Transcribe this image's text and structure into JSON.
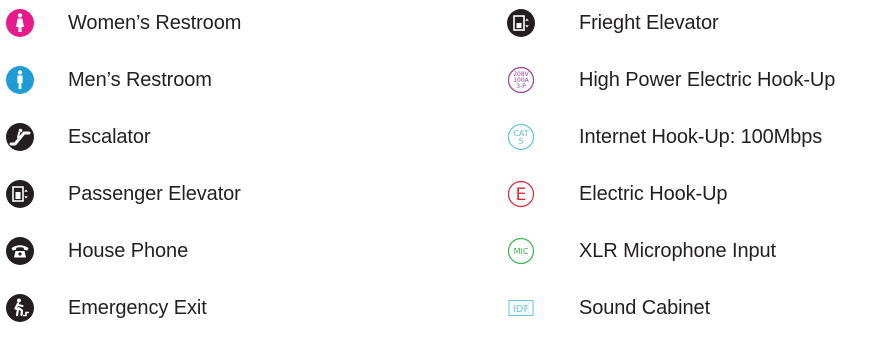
{
  "colors": {
    "women": "#e8198a",
    "men": "#1d9cd8",
    "dark": "#231f20",
    "high_power": "#9b3f98",
    "internet": "#5fc4e8",
    "electric": "#e8262e",
    "microphone": "#3bb54a",
    "sound_cabinet": "#5fc4e8"
  },
  "legend": {
    "left": [
      {
        "icon": "women-restroom-icon",
        "label": "Women’s Restroom"
      },
      {
        "icon": "men-restroom-icon",
        "label": "Men’s Restroom"
      },
      {
        "icon": "escalator-icon",
        "label": "Escalator"
      },
      {
        "icon": "passenger-elevator-icon",
        "label": "Passenger Elevator"
      },
      {
        "icon": "house-phone-icon",
        "label": "House Phone"
      },
      {
        "icon": "emergency-exit-icon",
        "label": "Emergency Exit"
      }
    ],
    "right": [
      {
        "icon": "freight-elevator-icon",
        "label": "Frieght Elevator"
      },
      {
        "icon": "high-power-electric-icon",
        "label": "High Power Electric Hook-Up",
        "glyph_lines": [
          "208V",
          "100A",
          "3-P"
        ]
      },
      {
        "icon": "internet-icon",
        "label": "Internet Hook-Up: 100Mbps",
        "glyph_lines": [
          "CAT",
          "5"
        ]
      },
      {
        "icon": "electric-icon",
        "label": "Electric Hook-Up",
        "glyph": "E"
      },
      {
        "icon": "microphone-icon",
        "label": "XLR Microphone Input",
        "glyph": "MIC"
      },
      {
        "icon": "sound-cabinet-icon",
        "label": "Sound Cabinet",
        "glyph": "IDF"
      }
    ]
  }
}
